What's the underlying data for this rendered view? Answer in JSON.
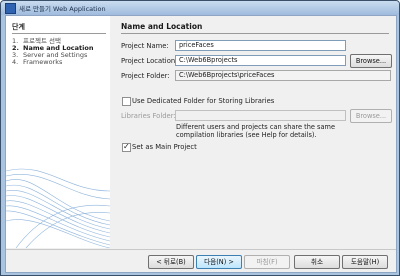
{
  "window": {
    "title": "새로 만들기 Web Application",
    "accent": "#2f62b0"
  },
  "steps": {
    "header": "단계",
    "items": [
      {
        "num": "1.",
        "label": "프로젝트 선택"
      },
      {
        "num": "2.",
        "label": "Name and Location"
      },
      {
        "num": "3.",
        "label": "Server and Settings"
      },
      {
        "num": "4.",
        "label": "Frameworks"
      }
    ]
  },
  "main": {
    "header": "Name and Location",
    "project_name": {
      "label": "Project Name:",
      "value": "priceFaces"
    },
    "project_location": {
      "label": "Project Location:",
      "value": "C:\\Web6Bprojects",
      "browse": "Browse..."
    },
    "project_folder": {
      "label": "Project Folder:",
      "value": "C:\\Web6Bprojects\\priceFaces"
    },
    "dedicated_folder": {
      "label": "Use Dedicated Folder for Storing Libraries",
      "checked": false
    },
    "libraries_folder": {
      "label": "Libraries Folder:",
      "value": "",
      "browse": "Browse..."
    },
    "note": "Different users and projects can share the same compilation libraries (see Help for details).",
    "main_project": {
      "label": "Set as Main Project",
      "checked": true
    }
  },
  "buttons": {
    "back": "< 뒤로(B)",
    "next": "다음(N) >",
    "finish": "마침(F)",
    "cancel": "취소",
    "help": "도움말(H)"
  }
}
